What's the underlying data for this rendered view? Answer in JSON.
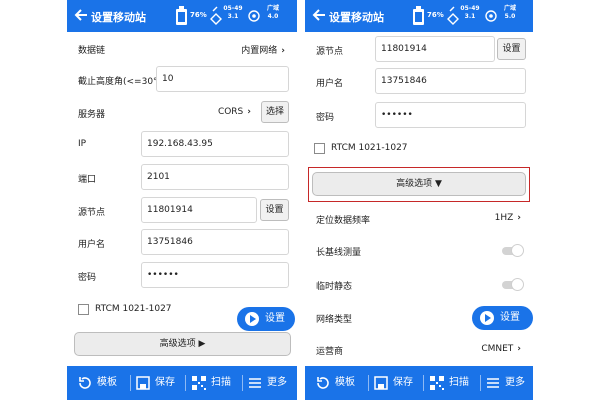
{
  "colors": {
    "primary": "#1a73e8",
    "highlight": "#c62828"
  },
  "status": {
    "battery": "76%",
    "sat_top": "05-49",
    "sat_bottom": "3.1",
    "signal_top": "广域",
    "signal_bottom_left": "4.0",
    "signal_bottom_right": "5.0"
  },
  "left": {
    "title": "设置移动站",
    "data_link_label": "数据链",
    "data_link_value": "内置网络",
    "cutoff_label": "截止高度角(<=30°)",
    "cutoff_value": "10",
    "server_label": "服务器",
    "server_value": "CORS",
    "select_button": "选择",
    "ip_label": "IP",
    "ip_value": "192.168.43.95",
    "port_label": "端口",
    "port_value": "2101",
    "mount_label": "源节点",
    "mount_value": "11801914",
    "settings_button": "设置",
    "user_label": "用户名",
    "user_value": "13751846",
    "password_label": "密码",
    "password_value": "••••••",
    "rtcm_label": "RTCM 1021-1027",
    "fab_label": "设置",
    "advanced_label": "高级选项 ▶"
  },
  "right": {
    "title": "设置移动站",
    "mount_label": "源节点",
    "mount_value": "11801914",
    "settings_button": "设置",
    "user_label": "用户名",
    "user_value": "13751846",
    "password_label": "密码",
    "password_value": "••••••",
    "rtcm_label": "RTCM 1021-1027",
    "advanced_label": "高级选项 ▼",
    "rate_label": "定位数据频率",
    "rate_value": "1HZ",
    "long_baseline_label": "长基线测量",
    "temp_static_label": "临时静态",
    "network_type_label": "网络类型",
    "fab_label": "设置",
    "carrier_label": "运营商",
    "carrier_value": "CMNET"
  },
  "bottom": {
    "template": "模板",
    "save": "保存",
    "scan": "扫描",
    "more": "更多"
  }
}
